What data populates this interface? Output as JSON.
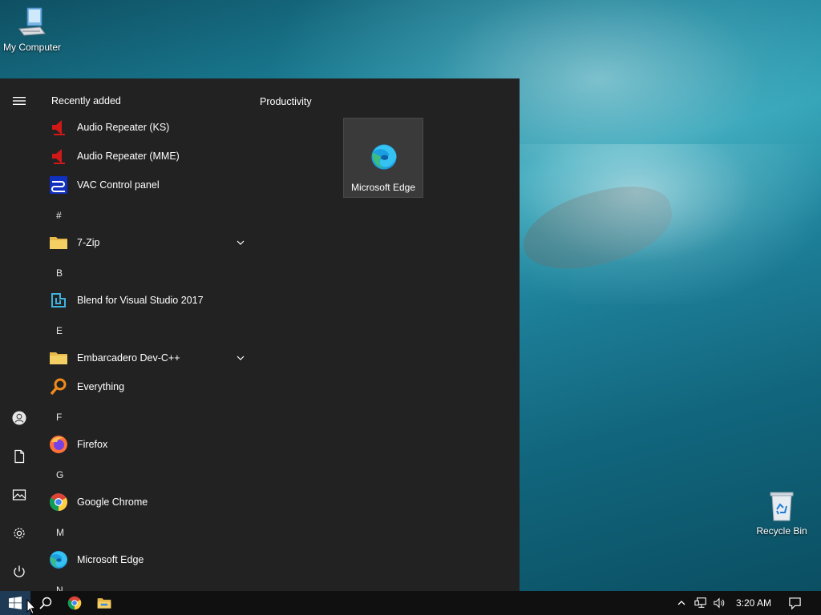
{
  "desktop": {
    "icons": [
      {
        "label": "My Computer"
      },
      {
        "label": "Recycle Bin"
      }
    ]
  },
  "start_menu": {
    "rail": [
      "hamburger-menu-icon",
      "user-account-icon",
      "documents-icon",
      "pictures-icon",
      "settings-gear-icon",
      "power-icon"
    ],
    "recently_added_label": "Recently added",
    "apps": [
      {
        "label": "Audio Repeater (KS)",
        "icon": "speaker-red-icon"
      },
      {
        "label": "Audio Repeater (MME)",
        "icon": "speaker-red-icon"
      },
      {
        "label": "VAC Control panel",
        "icon": "vac-cable-icon"
      },
      {
        "letter": "#"
      },
      {
        "label": "7-Zip",
        "icon": "folder-icon",
        "expandable": true
      },
      {
        "letter": "B"
      },
      {
        "label": "Blend for Visual Studio 2017",
        "icon": "blend-icon"
      },
      {
        "letter": "E"
      },
      {
        "label": "Embarcadero Dev-C++",
        "icon": "folder-icon",
        "expandable": true
      },
      {
        "label": "Everything",
        "icon": "magnifier-orange-icon"
      },
      {
        "letter": "F"
      },
      {
        "label": "Firefox",
        "icon": "firefox-icon"
      },
      {
        "letter": "G"
      },
      {
        "label": "Google Chrome",
        "icon": "chrome-icon"
      },
      {
        "letter": "M"
      },
      {
        "label": "Microsoft Edge",
        "icon": "edge-icon"
      },
      {
        "letter": "N"
      }
    ],
    "tiles": {
      "group_title": "Productivity",
      "items": [
        {
          "label": "Microsoft Edge",
          "icon": "edge-icon"
        }
      ]
    }
  },
  "taskbar": {
    "pinned": [
      "windows-start-icon",
      "search-icon",
      "chrome-icon",
      "file-explorer-icon"
    ],
    "tray": [
      "show-hidden-icons-chevron-icon",
      "network-icon",
      "volume-icon"
    ],
    "clock": "3:20 AM",
    "notification_icon": "action-center-icon"
  },
  "colors": {
    "start_menu_bg": "#222222",
    "taskbar_bg": "#101010",
    "tile_bg": "#3a3a3a"
  }
}
